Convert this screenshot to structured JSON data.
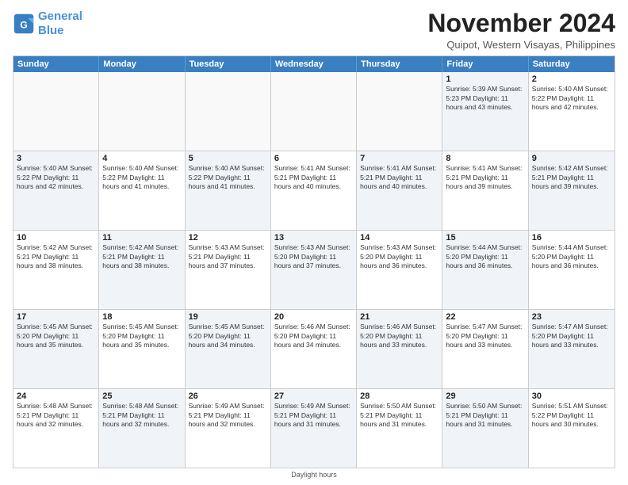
{
  "header": {
    "logo_line1": "General",
    "logo_line2": "Blue",
    "main_title": "November 2024",
    "subtitle": "Quipot, Western Visayas, Philippines"
  },
  "weekdays": [
    "Sunday",
    "Monday",
    "Tuesday",
    "Wednesday",
    "Thursday",
    "Friday",
    "Saturday"
  ],
  "rows": [
    [
      {
        "day": "",
        "detail": "",
        "empty": true
      },
      {
        "day": "",
        "detail": "",
        "empty": true
      },
      {
        "day": "",
        "detail": "",
        "empty": true
      },
      {
        "day": "",
        "detail": "",
        "empty": true
      },
      {
        "day": "",
        "detail": "",
        "empty": true
      },
      {
        "day": "1",
        "detail": "Sunrise: 5:39 AM\nSunset: 5:23 PM\nDaylight: 11 hours\nand 43 minutes.",
        "shaded": true
      },
      {
        "day": "2",
        "detail": "Sunrise: 5:40 AM\nSunset: 5:22 PM\nDaylight: 11 hours\nand 42 minutes.",
        "shaded": false
      }
    ],
    [
      {
        "day": "3",
        "detail": "Sunrise: 5:40 AM\nSunset: 5:22 PM\nDaylight: 11 hours\nand 42 minutes.",
        "shaded": true
      },
      {
        "day": "4",
        "detail": "Sunrise: 5:40 AM\nSunset: 5:22 PM\nDaylight: 11 hours\nand 41 minutes.",
        "shaded": false
      },
      {
        "day": "5",
        "detail": "Sunrise: 5:40 AM\nSunset: 5:22 PM\nDaylight: 11 hours\nand 41 minutes.",
        "shaded": true
      },
      {
        "day": "6",
        "detail": "Sunrise: 5:41 AM\nSunset: 5:21 PM\nDaylight: 11 hours\nand 40 minutes.",
        "shaded": false
      },
      {
        "day": "7",
        "detail": "Sunrise: 5:41 AM\nSunset: 5:21 PM\nDaylight: 11 hours\nand 40 minutes.",
        "shaded": true
      },
      {
        "day": "8",
        "detail": "Sunrise: 5:41 AM\nSunset: 5:21 PM\nDaylight: 11 hours\nand 39 minutes.",
        "shaded": false
      },
      {
        "day": "9",
        "detail": "Sunrise: 5:42 AM\nSunset: 5:21 PM\nDaylight: 11 hours\nand 39 minutes.",
        "shaded": true
      }
    ],
    [
      {
        "day": "10",
        "detail": "Sunrise: 5:42 AM\nSunset: 5:21 PM\nDaylight: 11 hours\nand 38 minutes.",
        "shaded": false
      },
      {
        "day": "11",
        "detail": "Sunrise: 5:42 AM\nSunset: 5:21 PM\nDaylight: 11 hours\nand 38 minutes.",
        "shaded": true
      },
      {
        "day": "12",
        "detail": "Sunrise: 5:43 AM\nSunset: 5:21 PM\nDaylight: 11 hours\nand 37 minutes.",
        "shaded": false
      },
      {
        "day": "13",
        "detail": "Sunrise: 5:43 AM\nSunset: 5:20 PM\nDaylight: 11 hours\nand 37 minutes.",
        "shaded": true
      },
      {
        "day": "14",
        "detail": "Sunrise: 5:43 AM\nSunset: 5:20 PM\nDaylight: 11 hours\nand 36 minutes.",
        "shaded": false
      },
      {
        "day": "15",
        "detail": "Sunrise: 5:44 AM\nSunset: 5:20 PM\nDaylight: 11 hours\nand 36 minutes.",
        "shaded": true
      },
      {
        "day": "16",
        "detail": "Sunrise: 5:44 AM\nSunset: 5:20 PM\nDaylight: 11 hours\nand 36 minutes.",
        "shaded": false
      }
    ],
    [
      {
        "day": "17",
        "detail": "Sunrise: 5:45 AM\nSunset: 5:20 PM\nDaylight: 11 hours\nand 35 minutes.",
        "shaded": true
      },
      {
        "day": "18",
        "detail": "Sunrise: 5:45 AM\nSunset: 5:20 PM\nDaylight: 11 hours\nand 35 minutes.",
        "shaded": false
      },
      {
        "day": "19",
        "detail": "Sunrise: 5:45 AM\nSunset: 5:20 PM\nDaylight: 11 hours\nand 34 minutes.",
        "shaded": true
      },
      {
        "day": "20",
        "detail": "Sunrise: 5:46 AM\nSunset: 5:20 PM\nDaylight: 11 hours\nand 34 minutes.",
        "shaded": false
      },
      {
        "day": "21",
        "detail": "Sunrise: 5:46 AM\nSunset: 5:20 PM\nDaylight: 11 hours\nand 33 minutes.",
        "shaded": true
      },
      {
        "day": "22",
        "detail": "Sunrise: 5:47 AM\nSunset: 5:20 PM\nDaylight: 11 hours\nand 33 minutes.",
        "shaded": false
      },
      {
        "day": "23",
        "detail": "Sunrise: 5:47 AM\nSunset: 5:20 PM\nDaylight: 11 hours\nand 33 minutes.",
        "shaded": true
      }
    ],
    [
      {
        "day": "24",
        "detail": "Sunrise: 5:48 AM\nSunset: 5:21 PM\nDaylight: 11 hours\nand 32 minutes.",
        "shaded": false
      },
      {
        "day": "25",
        "detail": "Sunrise: 5:48 AM\nSunset: 5:21 PM\nDaylight: 11 hours\nand 32 minutes.",
        "shaded": true
      },
      {
        "day": "26",
        "detail": "Sunrise: 5:49 AM\nSunset: 5:21 PM\nDaylight: 11 hours\nand 32 minutes.",
        "shaded": false
      },
      {
        "day": "27",
        "detail": "Sunrise: 5:49 AM\nSunset: 5:21 PM\nDaylight: 11 hours\nand 31 minutes.",
        "shaded": true
      },
      {
        "day": "28",
        "detail": "Sunrise: 5:50 AM\nSunset: 5:21 PM\nDaylight: 11 hours\nand 31 minutes.",
        "shaded": false
      },
      {
        "day": "29",
        "detail": "Sunrise: 5:50 AM\nSunset: 5:21 PM\nDaylight: 11 hours\nand 31 minutes.",
        "shaded": true
      },
      {
        "day": "30",
        "detail": "Sunrise: 5:51 AM\nSunset: 5:22 PM\nDaylight: 11 hours\nand 30 minutes.",
        "shaded": false
      }
    ]
  ],
  "footer": "Daylight hours"
}
